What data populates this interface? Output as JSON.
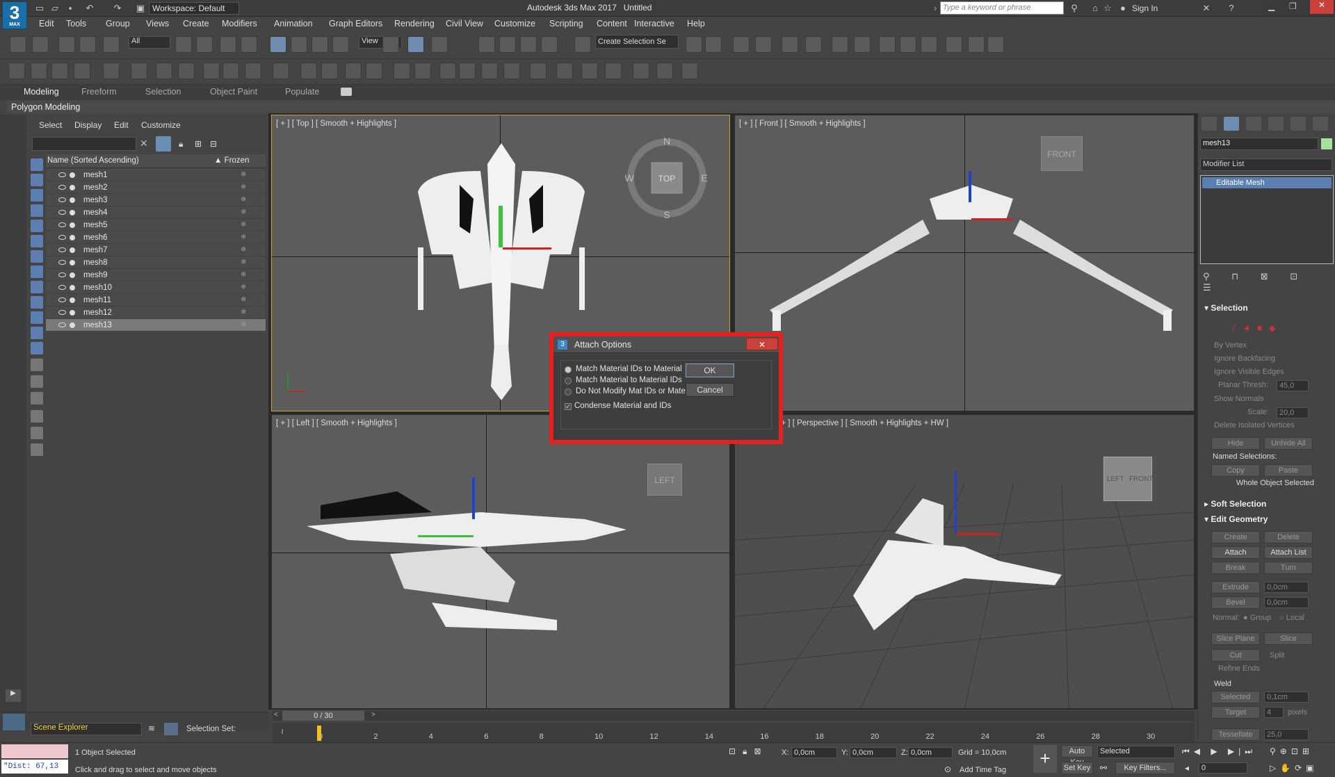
{
  "title_bar": {
    "workspace": "Workspace: Default",
    "app_title": "Autodesk 3ds Max 2017",
    "file": "Untitled",
    "search_placeholder": "Type a keyword or phrase",
    "sign_in": "Sign In",
    "logo": "3",
    "logo_sub": "MAX"
  },
  "menu": [
    "Edit",
    "Tools",
    "Group",
    "Views",
    "Create",
    "Modifiers",
    "Animation",
    "Graph Editors",
    "Rendering",
    "Civil View",
    "Customize",
    "Scripting",
    "Content",
    "Interactive",
    "Help"
  ],
  "toolbar": {
    "filter": "All",
    "view": "View",
    "selection_set": "Create Selection Se"
  },
  "ribbon_tabs": [
    "Modeling",
    "Freeform",
    "Selection",
    "Object Paint",
    "Populate"
  ],
  "ribbon_panel": "Polygon Modeling",
  "scene_explorer": {
    "menus": [
      "Select",
      "Display",
      "Edit",
      "Customize"
    ],
    "col_name": "Name (Sorted Ascending)",
    "col_frozen": "▲ Frozen",
    "items": [
      "mesh1",
      "mesh2",
      "mesh3",
      "mesh4",
      "mesh5",
      "mesh6",
      "mesh7",
      "mesh8",
      "mesh9",
      "mesh10",
      "mesh11",
      "mesh12",
      "mesh13"
    ],
    "selected": "mesh13",
    "footer": "Scene Explorer",
    "selection_set": "Selection Set:"
  },
  "viewports": {
    "top": "[ + ] [ Top ] [ Smooth + Highlights ]",
    "front": "[ + ] [ Front ] [ Smooth + Highlights ]",
    "left": "[ + ] [ Left ] [ Smooth + Highlights ]",
    "persp": "[ + ] [ Perspective ] [ Smooth + Highlights + HW ]",
    "compass": {
      "n": "N",
      "s": "S",
      "e": "E",
      "w": "W",
      "cube": "TOP"
    },
    "front_cube": "FRONT",
    "left_cube": "LEFT",
    "persp_cube_a": "LEFT",
    "persp_cube_b": "FRONT"
  },
  "dialog": {
    "title": "Attach Options",
    "options": [
      "Match Material IDs to Material",
      "Match Material to Material IDs",
      "Do Not Modify Mat IDs or Material"
    ],
    "checkbox": "Condense Material and IDs",
    "ok": "OK",
    "cancel": "Cancel"
  },
  "command_panel": {
    "object_name": "mesh13",
    "modifier_list": "Modifier List",
    "stack_item": "Editable Mesh",
    "selection": {
      "header": "Selection",
      "by_vertex": "By Vertex",
      "ignore_backfacing": "Ignore Backfacing",
      "ignore_visible": "Ignore Visible Edges",
      "planar_thresh": "Planar Thresh:",
      "planar_val": "45,0",
      "show_normals": "Show Normals",
      "scale": "Scale:",
      "scale_val": "20,0",
      "delete_isolated": "Delete Isolated Vertices",
      "hide": "Hide",
      "unhide_all": "Unhide All",
      "named_sel": "Named Selections:",
      "copy": "Copy",
      "paste": "Paste",
      "whole_object": "Whole Object Selected"
    },
    "soft_selection": "Soft Selection",
    "edit_geometry": {
      "header": "Edit Geometry",
      "create": "Create",
      "delete": "Delete",
      "attach": "Attach",
      "attach_list": "Attach List",
      "break": "Break",
      "turn": "Turn",
      "extrude": "Extrude",
      "extrude_val": "0,0cm",
      "bevel": "Bevel",
      "bevel_val": "0,0cm",
      "normal": "Normal:",
      "group": "Group",
      "local": "Local",
      "slice_plane": "Slice Plane",
      "slice": "Slice",
      "cut": "Cut",
      "split": "Split",
      "refine_ends": "Refine Ends",
      "weld": "Weld",
      "selected": "Selected",
      "selected_val": "0,1cm",
      "target": "Target",
      "target_val": "4",
      "pixels": "pixels",
      "tessellate": "Tessellate",
      "tessellate_val": "25,0"
    }
  },
  "timeline": {
    "frame": "0 / 30",
    "ticks": [
      "0",
      "2",
      "4",
      "6",
      "8",
      "10",
      "12",
      "14",
      "16",
      "18",
      "20",
      "22",
      "24",
      "26",
      "28",
      "30"
    ]
  },
  "status": {
    "maxscript": "\"Dist: 67,13",
    "selected": "1 Object Selected",
    "prompt": "Click and drag to select and move objects",
    "x_label": "X:",
    "x": "0,0cm",
    "y_label": "Y:",
    "y": "0,0cm",
    "z_label": "Z:",
    "z": "0,0cm",
    "grid": "Grid = 10,0cm",
    "add_time_tag": "Add Time Tag",
    "auto_key": "Auto Key",
    "set_key": "Set Key",
    "key_mode": "Selected",
    "key_filters": "Key Filters...",
    "frame_field": "0"
  }
}
